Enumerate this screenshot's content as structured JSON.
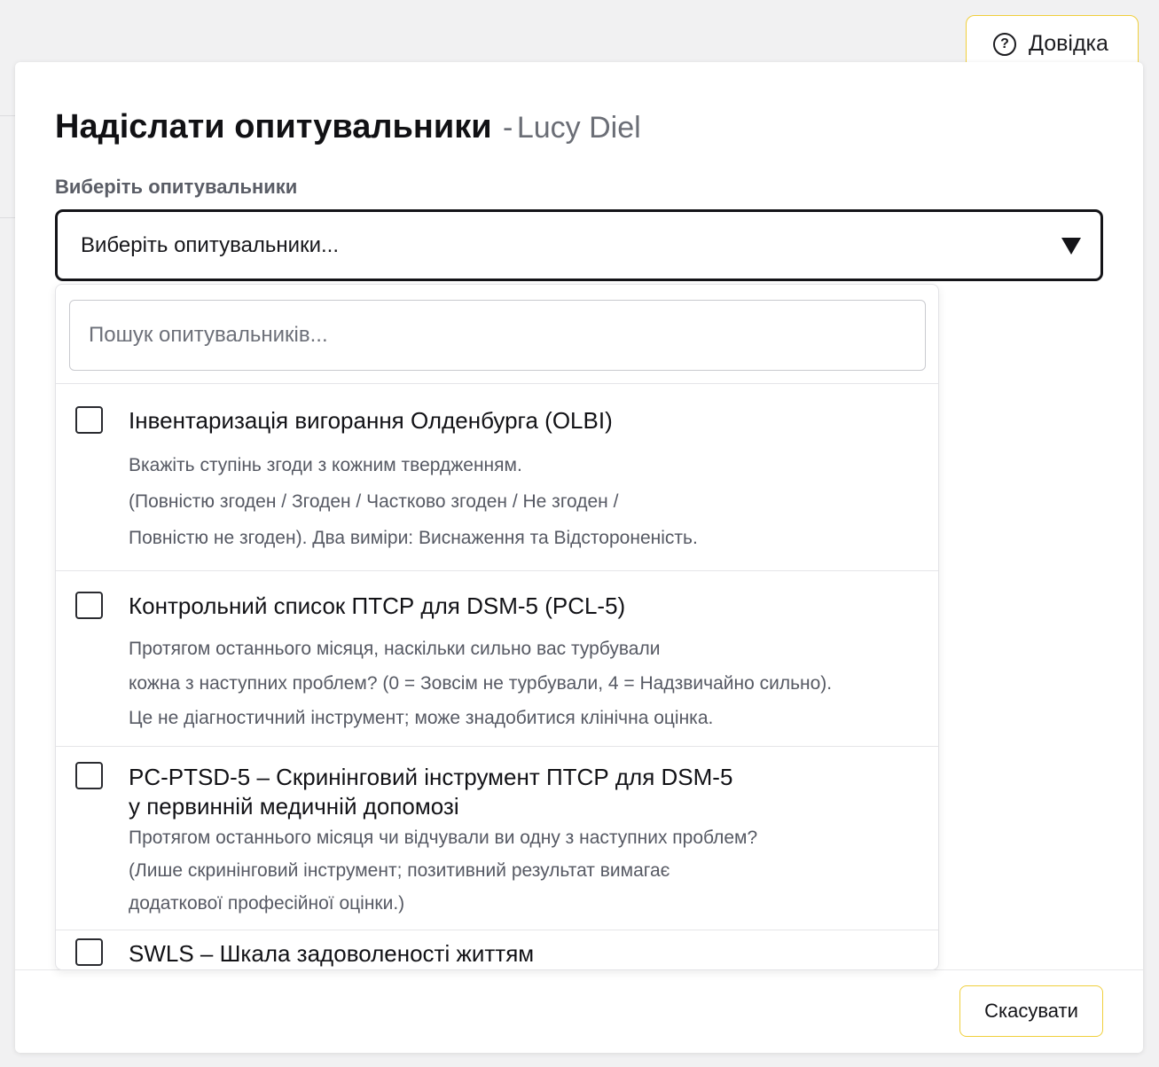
{
  "help": {
    "label": "Довідка",
    "icon": "question-circle-icon"
  },
  "modal": {
    "title": "Надіслати опитувальники",
    "title_separator": "-",
    "client_name": "Lucy Diel",
    "field_label": "Виберіть опитувальники",
    "select_placeholder": "Виберіть опитувальники...",
    "search_placeholder": "Пошук опитувальників...",
    "cancel_label": "Скасувати"
  },
  "options": [
    {
      "title": "Інвентаризація вигорання Олденбурга (OLBI)",
      "desc": [
        "Вкажіть ступінь згоди з кожним твердженням.",
        "(Повністю згоден / Згоден / Частково згоден / Не згоден /",
        "Повністю не згоден). Два виміри: Виснаження та Відстороненість."
      ],
      "checked": false
    },
    {
      "title": "Контрольний список ПТСР для DSM-5 (PCL-5)",
      "desc": [
        "Протягом останнього місяця, наскільки сильно вас турбували",
        "кожна з наступних проблем? (0 = Зовсім не турбували, 4 = Надзвичайно сильно).",
        "Це не діагностичний інструмент; може знадобитися клінічна оцінка."
      ],
      "checked": false
    },
    {
      "title_line1": "PC-PTSD-5 – Скринінговий інструмент ПТСР для DSM-5",
      "title_line2": "у первинній медичній допомозі",
      "desc": [
        "Протягом останнього місяця чи відчували ви одну з наступних проблем?",
        "(Лише скринінговий інструмент; позитивний результат вимагає",
        "додаткової професійної оцінки.)"
      ],
      "checked": false
    },
    {
      "title": "SWLS – Шкала задоволеності життям",
      "checked": false
    }
  ]
}
